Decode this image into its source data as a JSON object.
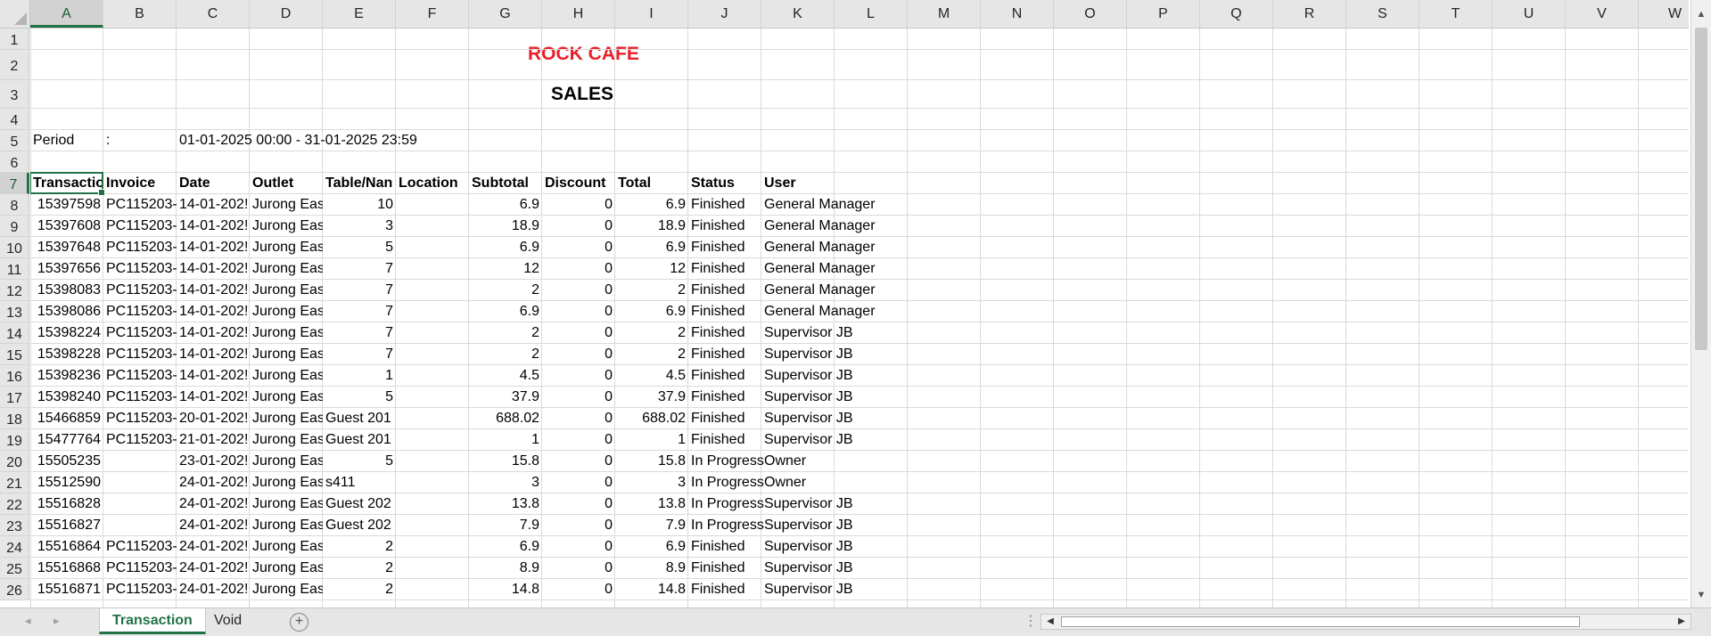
{
  "columns": [
    "A",
    "B",
    "C",
    "D",
    "E",
    "F",
    "G",
    "H",
    "I",
    "J",
    "K",
    "L",
    "M",
    "N",
    "O",
    "P",
    "Q",
    "R",
    "S",
    "T",
    "U",
    "V",
    "W"
  ],
  "active_column": "A",
  "active_row": 7,
  "title": "ROCK CAFE",
  "subtitle": "SALES",
  "title_color": "#e8202a",
  "accent_color": "#217346",
  "period": {
    "label": "Period",
    "sep": ":",
    "value": "01-01-2025 00:00 - 31-01-2025 23:59"
  },
  "headers": [
    "Transactio",
    "Invoice",
    "Date",
    "Outlet",
    "Table/Nan",
    "Location",
    "Subtotal",
    "Discount",
    "Total",
    "Status",
    "User"
  ],
  "rows": [
    [
      "15397598",
      "PC115203-",
      "14-01-202!",
      "Jurong Eas",
      "10",
      "",
      "6.9",
      "0",
      "6.9",
      "Finished",
      "General Manager"
    ],
    [
      "15397608",
      "PC115203-",
      "14-01-202!",
      "Jurong Eas",
      "3",
      "",
      "18.9",
      "0",
      "18.9",
      "Finished",
      "General Manager"
    ],
    [
      "15397648",
      "PC115203-",
      "14-01-202!",
      "Jurong Eas",
      "5",
      "",
      "6.9",
      "0",
      "6.9",
      "Finished",
      "General Manager"
    ],
    [
      "15397656",
      "PC115203-",
      "14-01-202!",
      "Jurong Eas",
      "7",
      "",
      "12",
      "0",
      "12",
      "Finished",
      "General Manager"
    ],
    [
      "15398083",
      "PC115203-",
      "14-01-202!",
      "Jurong Eas",
      "7",
      "",
      "2",
      "0",
      "2",
      "Finished",
      "General Manager"
    ],
    [
      "15398086",
      "PC115203-",
      "14-01-202!",
      "Jurong Eas",
      "7",
      "",
      "6.9",
      "0",
      "6.9",
      "Finished",
      "General Manager"
    ],
    [
      "15398224",
      "PC115203-",
      "14-01-202!",
      "Jurong Eas",
      "7",
      "",
      "2",
      "0",
      "2",
      "Finished",
      "Supervisor JB"
    ],
    [
      "15398228",
      "PC115203-",
      "14-01-202!",
      "Jurong Eas",
      "7",
      "",
      "2",
      "0",
      "2",
      "Finished",
      "Supervisor JB"
    ],
    [
      "15398236",
      "PC115203-",
      "14-01-202!",
      "Jurong Eas",
      "1",
      "",
      "4.5",
      "0",
      "4.5",
      "Finished",
      "Supervisor JB"
    ],
    [
      "15398240",
      "PC115203-",
      "14-01-202!",
      "Jurong Eas",
      "5",
      "",
      "37.9",
      "0",
      "37.9",
      "Finished",
      "Supervisor JB"
    ],
    [
      "15466859",
      "PC115203-",
      "20-01-202!",
      "Jurong Eas",
      "Guest 201",
      "",
      "688.02",
      "0",
      "688.02",
      "Finished",
      "Supervisor JB"
    ],
    [
      "15477764",
      "PC115203-",
      "21-01-202!",
      "Jurong Eas",
      "Guest 201",
      "",
      "1",
      "0",
      "1",
      "Finished",
      "Supervisor JB"
    ],
    [
      "15505235",
      "",
      "23-01-202!",
      "Jurong Eas",
      "5",
      "",
      "15.8",
      "0",
      "15.8",
      "In Progress",
      "Owner"
    ],
    [
      "15512590",
      "",
      "24-01-202!",
      "Jurong Eas",
      "s411",
      "",
      "3",
      "0",
      "3",
      "In Progress",
      "Owner"
    ],
    [
      "15516828",
      "",
      "24-01-202!",
      "Jurong Eas",
      "Guest 202",
      "",
      "13.8",
      "0",
      "13.8",
      "In Progress",
      "Supervisor JB"
    ],
    [
      "15516827",
      "",
      "24-01-202!",
      "Jurong Eas",
      "Guest 202",
      "",
      "7.9",
      "0",
      "7.9",
      "In Progress",
      "Supervisor JB"
    ],
    [
      "15516864",
      "PC115203-",
      "24-01-202!",
      "Jurong Eas",
      "2",
      "",
      "6.9",
      "0",
      "6.9",
      "Finished",
      "Supervisor JB"
    ],
    [
      "15516868",
      "PC115203-",
      "24-01-202!",
      "Jurong Eas",
      "2",
      "",
      "8.9",
      "0",
      "8.9",
      "Finished",
      "Supervisor JB"
    ],
    [
      "15516871",
      "PC115203-",
      "24-01-202!",
      "Jurong Eas",
      "2",
      "",
      "14.8",
      "0",
      "14.8",
      "Finished",
      "Supervisor JB"
    ]
  ],
  "tabs": [
    {
      "label": "Transaction",
      "active": true
    },
    {
      "label": "Void",
      "active": false
    }
  ],
  "icons": {
    "add_sheet": "plus-circle-icon",
    "scroll_left": "triangle-left-icon",
    "scroll_right": "triangle-right-icon"
  }
}
